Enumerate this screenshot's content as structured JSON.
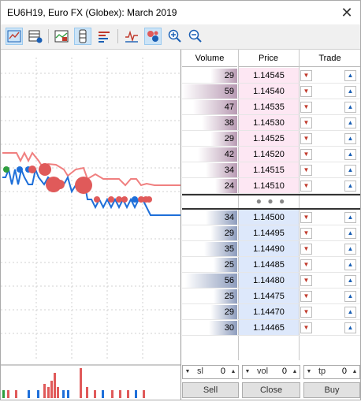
{
  "window": {
    "title": "EU6H19, Euro FX (Globex): March 2019",
    "close_glyph": "✕"
  },
  "toolbar": {
    "buttons": [
      "chart-icon",
      "table-icon",
      "depth-chart-icon",
      "ladder-icon",
      "dom-icon",
      "ticks-icon",
      "bubbles-icon",
      "zoom-in-icon",
      "zoom-out-icon"
    ]
  },
  "book": {
    "headers": {
      "volume": "Volume",
      "price": "Price",
      "trade": "Trade"
    },
    "asks": [
      {
        "volume": "29",
        "price": "1.14545"
      },
      {
        "volume": "59",
        "price": "1.14540"
      },
      {
        "volume": "47",
        "price": "1.14535"
      },
      {
        "volume": "38",
        "price": "1.14530"
      },
      {
        "volume": "29",
        "price": "1.14525"
      },
      {
        "volume": "42",
        "price": "1.14520"
      },
      {
        "volume": "34",
        "price": "1.14515"
      },
      {
        "volume": "24",
        "price": "1.14510"
      }
    ],
    "spread_glyph": "● ● ●",
    "bids": [
      {
        "volume": "34",
        "price": "1.14500"
      },
      {
        "volume": "29",
        "price": "1.14495"
      },
      {
        "volume": "35",
        "price": "1.14490"
      },
      {
        "volume": "25",
        "price": "1.14485"
      },
      {
        "volume": "56",
        "price": "1.14480"
      },
      {
        "volume": "25",
        "price": "1.14475"
      },
      {
        "volume": "29",
        "price": "1.14470"
      },
      {
        "volume": "30",
        "price": "1.14465"
      }
    ],
    "sell_arrow": "▼",
    "buy_arrow": "▲"
  },
  "controls": {
    "sl_label": "sl",
    "sl_value": "0",
    "vol_label": "vol",
    "vol_value": "0",
    "tp_label": "tp",
    "tp_value": "0",
    "down": "▼",
    "up": "▲",
    "sell": "Sell",
    "close": "Close",
    "buy": "Buy"
  },
  "colors": {
    "ask_line": "#f08080",
    "bid_line": "#1e6fd9",
    "ask_price_bg": "#fde7f3",
    "bid_price_bg": "#dde8fb"
  }
}
